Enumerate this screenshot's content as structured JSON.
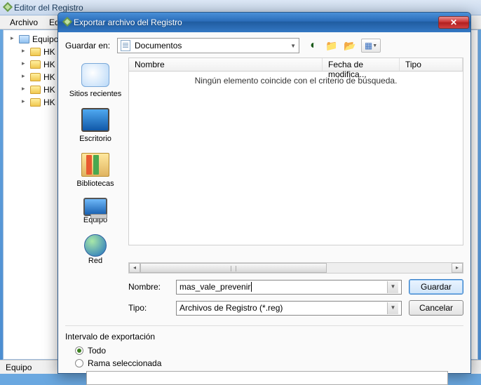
{
  "parent": {
    "title": "Editor del Registro",
    "menu": {
      "file": "Archivo",
      "edit": "Ed"
    },
    "tree": {
      "root": "Equipo",
      "items": [
        "HK",
        "HK",
        "HK",
        "HK",
        "HK"
      ]
    },
    "status": "Equipo"
  },
  "dialog": {
    "title": "Exportar archivo del Registro",
    "savein_label": "Guardar en:",
    "savein_value": "Documentos",
    "toolbar": {
      "back": "←",
      "up": "↑",
      "new": "✳",
      "views": "▦"
    },
    "columns": {
      "name": "Nombre",
      "date": "Fecha de modifica...",
      "type": "Tipo"
    },
    "empty_msg": "Ningún elemento coincide con el criterio de búsqueda.",
    "places": {
      "recent": "Sitios recientes",
      "desktop": "Escritorio",
      "libraries": "Bibliotecas",
      "computer": "Equipo",
      "network": "Red"
    },
    "filename_label": "Nombre:",
    "filename_value": "mas_vale_prevenir",
    "type_label": "Tipo:",
    "type_value": "Archivos de Registro (*.reg)",
    "save_btn": "Guardar",
    "cancel_btn": "Cancelar",
    "export_group": "Intervalo de exportación",
    "radio_all": "Todo",
    "radio_branch": "Rama seleccionada"
  }
}
